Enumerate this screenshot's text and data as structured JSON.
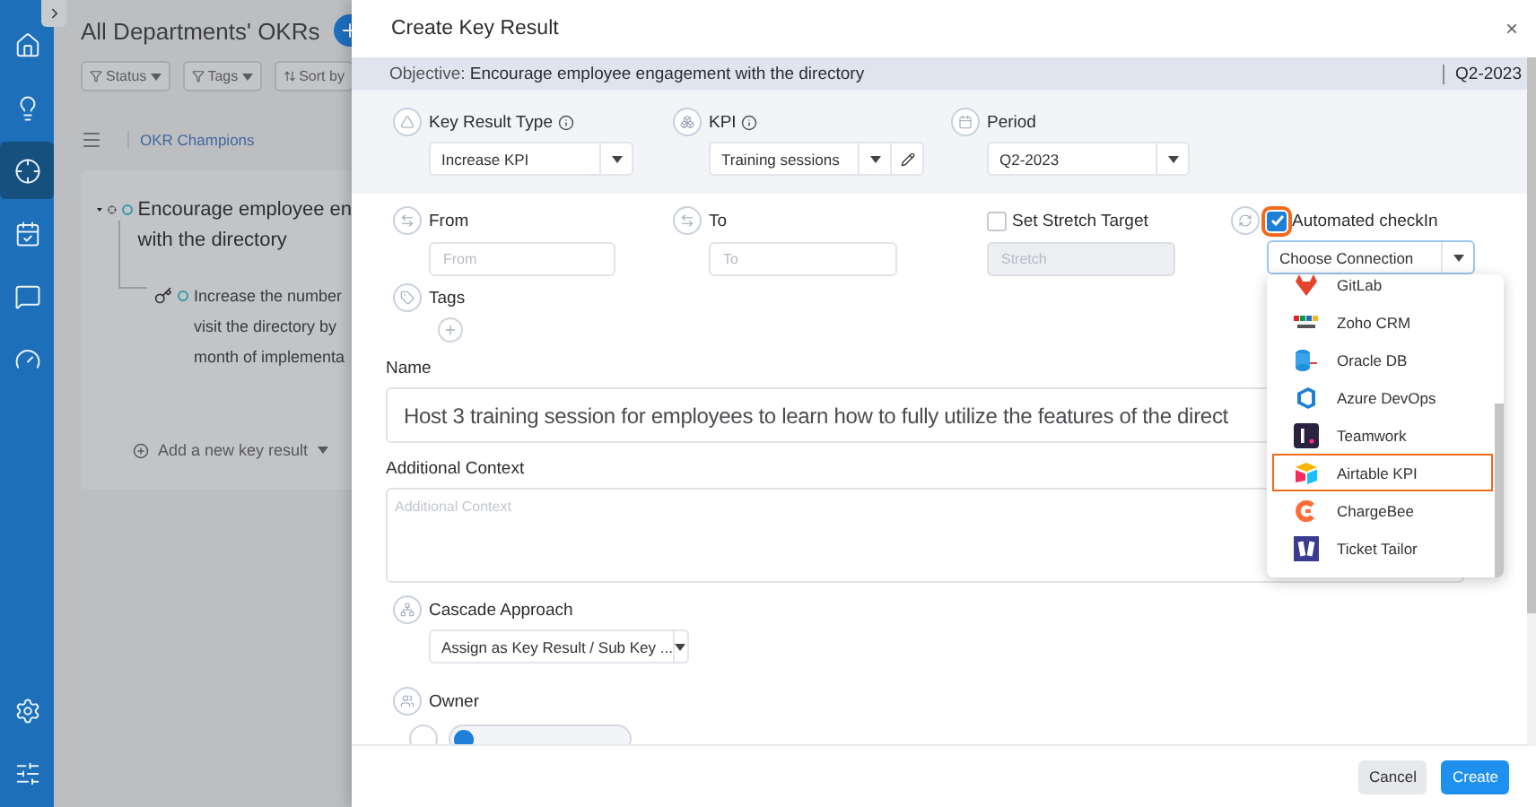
{
  "sidebar": {
    "items": [
      {
        "selected": false
      },
      {
        "selected": false
      },
      {
        "selected": true
      },
      {
        "selected": false
      },
      {
        "selected": false
      },
      {
        "selected": false
      }
    ]
  },
  "background_page": {
    "title": "All Departments' OKRs",
    "filters": [
      {
        "label": "Status",
        "kind": "filter"
      },
      {
        "label": "Tags",
        "kind": "filter"
      },
      {
        "label": "Sort by",
        "kind": "sort"
      }
    ],
    "breadcrumb": "OKR Champions",
    "objective": {
      "expanded": true,
      "lines": [
        "Encourage employee en",
        "with the directory"
      ],
      "key_results": [
        {
          "lines": [
            "Increase the number",
            "visit the directory by",
            "month of implementa"
          ]
        }
      ]
    },
    "add_key_result": "Add a new key result"
  },
  "dialog": {
    "title": "Create Key Result",
    "close": "×",
    "objective_label": "Objective:",
    "objective": "Encourage employee engagement with the directory",
    "period": "Q2-2023",
    "top_fields": [
      {
        "label": "Key Result Type",
        "info": true,
        "value": "Increase KPI",
        "editable": false
      },
      {
        "label": "KPI",
        "info": true,
        "value": "Training sessions",
        "editable": true
      },
      {
        "label": "Period",
        "info": false,
        "value": "Q2-2023",
        "editable": false
      }
    ],
    "from": {
      "label": "From",
      "placeholder": "From"
    },
    "to": {
      "label": "To",
      "placeholder": "To"
    },
    "stretch": {
      "label": "Set Stretch Target",
      "checked": false,
      "placeholder": "Stretch"
    },
    "automated": {
      "label": "Automated checkIn",
      "checked": true,
      "highlighted": true,
      "select": "Choose Connection",
      "open": true
    },
    "tags_label": "Tags",
    "name_label": "Name",
    "name_value": "Host 3 training session for employees to learn how to fully utilize the features of the direct",
    "context_label": "Additional Context",
    "context_placeholder": "Additional Context",
    "cascade_label": "Cascade Approach",
    "cascade_value": "Assign as Key Result / Sub Key ...",
    "owner_label": "Owner",
    "connections": [
      {
        "name": "GitLab",
        "selected": false
      },
      {
        "name": "Zoho CRM",
        "selected": false
      },
      {
        "name": "Oracle DB",
        "selected": false
      },
      {
        "name": "Azure DevOps",
        "selected": false
      },
      {
        "name": "Teamwork",
        "selected": false
      },
      {
        "name": "Airtable KPI",
        "selected": true
      },
      {
        "name": "ChargeBee",
        "selected": false
      },
      {
        "name": "Ticket Tailor",
        "selected": false
      }
    ],
    "buttons": [
      {
        "label": "Cancel",
        "kind": "secondary"
      },
      {
        "label": "Create",
        "kind": "primary"
      }
    ]
  }
}
